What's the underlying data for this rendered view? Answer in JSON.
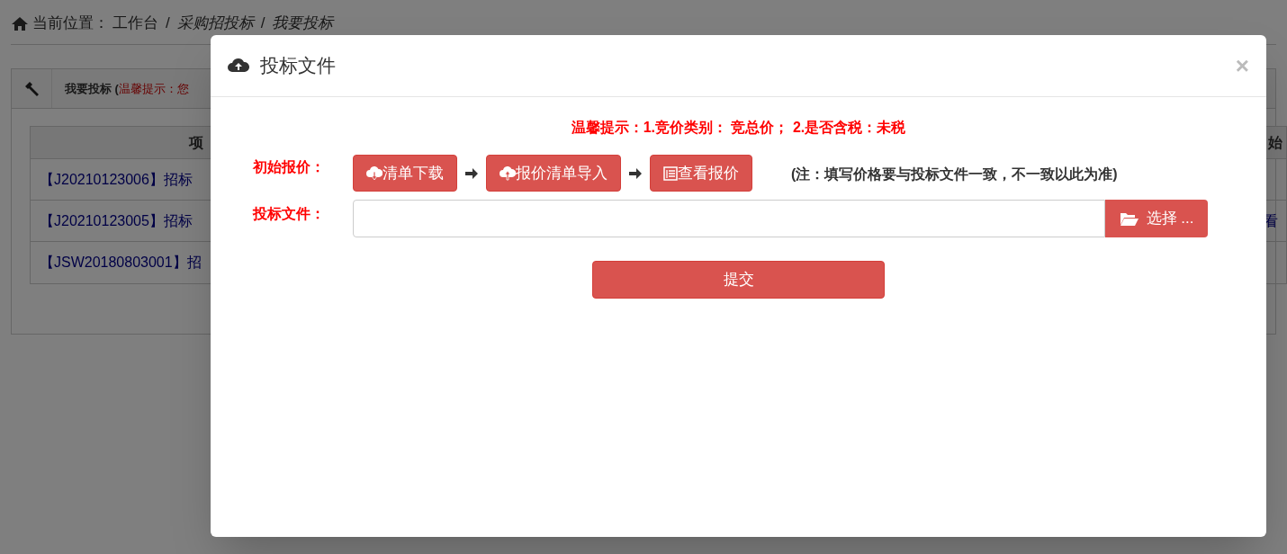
{
  "breadcrumb": {
    "label": "当前位置：",
    "separator": "/",
    "items": [
      {
        "text": "工作台",
        "current": false
      },
      {
        "text": "采购招投标",
        "current": true
      },
      {
        "text": "我要投标",
        "current": true
      }
    ]
  },
  "panel": {
    "title": "我要投标 (",
    "tip": "温馨提示：您"
  },
  "table": {
    "header_left": "项",
    "header_right": "始",
    "rows": [
      {
        "left": "【J20210123006】招标"
      },
      {
        "left": "【J20210123005】招标",
        "right": "看"
      },
      {
        "left": "【JSW20180803001】招"
      }
    ]
  },
  "modal": {
    "title": "投标文件",
    "close": "×",
    "notice": "温馨提示：1.竞价类别： 竞总价； 2.是否含税：未税",
    "price_label": "初始报价：",
    "steps": [
      {
        "label": "清单下载",
        "kind": "download"
      },
      {
        "label": "报价清单导入",
        "kind": "upload"
      },
      {
        "label": "查看报价",
        "kind": "list"
      }
    ],
    "note": "(注：填写价格要与投标文件一致，不一致以此为准)",
    "file_label": "投标文件：",
    "choose": "选择 ...",
    "submit": "提交"
  }
}
